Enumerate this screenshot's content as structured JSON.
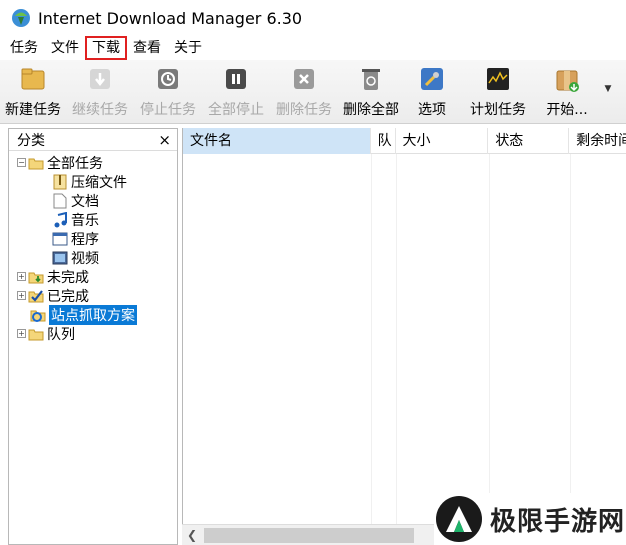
{
  "window": {
    "title": "Internet Download Manager 6.30"
  },
  "menu": [
    {
      "label": "任务"
    },
    {
      "label": "文件"
    },
    {
      "label": "下载",
      "highlighted": true
    },
    {
      "label": "查看"
    },
    {
      "label": "关于"
    }
  ],
  "toolbar": [
    {
      "label": "新建任务",
      "icon": "new-task-icon",
      "enabled": true
    },
    {
      "label": "继续任务",
      "icon": "resume-icon",
      "enabled": false
    },
    {
      "label": "停止任务",
      "icon": "stop-icon",
      "enabled": false
    },
    {
      "label": "全部停止",
      "icon": "stop-all-icon",
      "enabled": false
    },
    {
      "label": "删除任务",
      "icon": "delete-icon",
      "enabled": false
    },
    {
      "label": "删除全部",
      "icon": "delete-all-icon",
      "enabled": true
    },
    {
      "label": "选项",
      "icon": "options-icon",
      "enabled": true
    },
    {
      "label": "计划任务",
      "icon": "scheduler-icon",
      "enabled": true
    },
    {
      "label": "开始...",
      "icon": "start-queue-icon",
      "enabled": true
    }
  ],
  "left_pane": {
    "header": "分类",
    "close_glyph": "×",
    "tree": [
      {
        "label": "全部任务",
        "level": 0,
        "toggle": "−",
        "icon": "folder-open-icon"
      },
      {
        "label": "压缩文件",
        "level": 1,
        "icon": "archive-icon"
      },
      {
        "label": "文档",
        "level": 1,
        "icon": "document-icon"
      },
      {
        "label": "音乐",
        "level": 1,
        "icon": "music-icon"
      },
      {
        "label": "程序",
        "level": 1,
        "icon": "program-icon"
      },
      {
        "label": "视频",
        "level": 1,
        "icon": "video-icon"
      },
      {
        "label": "未完成",
        "level": 0,
        "toggle": "+",
        "icon": "unfinished-folder-icon"
      },
      {
        "label": "已完成",
        "level": 0,
        "toggle": "+",
        "icon": "finished-folder-icon"
      },
      {
        "label": "站点抓取方案",
        "level": 0,
        "icon": "site-grabber-icon",
        "selected": true
      },
      {
        "label": "队列",
        "level": 0,
        "toggle": "+",
        "icon": "queue-folder-icon"
      }
    ]
  },
  "file_list": {
    "columns": [
      "文件名",
      "队",
      "大小",
      "状态",
      "剩余时间"
    ],
    "rows": []
  },
  "watermark": {
    "text": "极限手游网"
  }
}
